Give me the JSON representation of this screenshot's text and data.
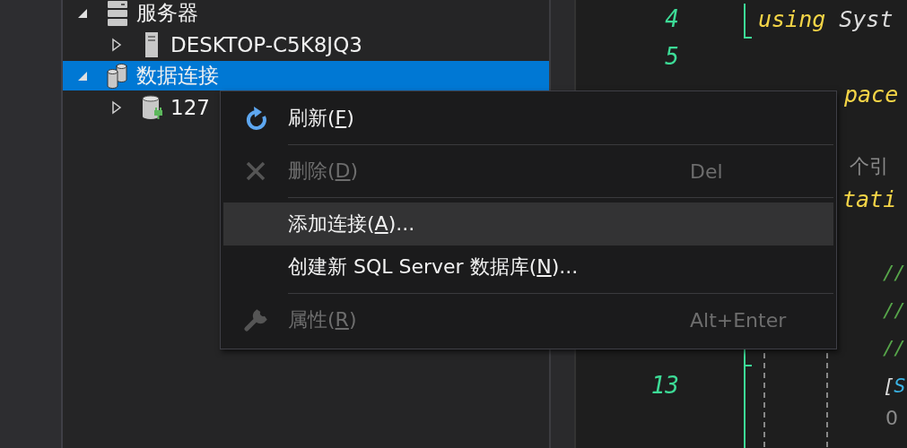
{
  "tree": {
    "items": [
      {
        "label": "服务器",
        "kind": "server",
        "expanded": true,
        "selected": false,
        "children": [
          {
            "label": "DESKTOP-C5K8JQ3",
            "kind": "computer",
            "expanded": false,
            "selected": false
          }
        ]
      },
      {
        "label": "数据连接",
        "kind": "databases",
        "expanded": true,
        "selected": true,
        "children": [
          {
            "label": "127",
            "kind": "database",
            "expanded": false,
            "selected": false
          }
        ]
      }
    ]
  },
  "editor": {
    "lines": [
      {
        "number": "4",
        "kind": "top",
        "tokens": [
          {
            "text": "using",
            "kind": "keyword"
          },
          {
            "text": "Syst",
            "kind": "plain"
          }
        ]
      },
      {
        "number": "5",
        "kind": "top"
      },
      {
        "kind": "behind",
        "tokens": [
          {
            "text": "pace",
            "kind": "keyword"
          }
        ]
      },
      {
        "kind": "hint",
        "tokens": [
          {
            "text": "个引",
            "kind": "hint"
          }
        ]
      },
      {
        "kind": "mid",
        "tokens": [
          {
            "text": "tati",
            "kind": "keyword"
          }
        ]
      },
      {
        "kind": "inner",
        "tokens": [
          {
            "text": "//",
            "kind": "comment"
          }
        ]
      },
      {
        "kind": "inner",
        "tokens": [
          {
            "text": "//",
            "kind": "comment"
          }
        ]
      },
      {
        "kind": "inner",
        "tokens": [
          {
            "text": "//",
            "kind": "comment"
          }
        ]
      },
      {
        "number": "13",
        "kind": "inner",
        "tokens": [
          {
            "text": "[",
            "kind": "plain"
          },
          {
            "text": "S",
            "kind": "type"
          }
        ]
      },
      {
        "kind": "hint-inner",
        "tokens": [
          {
            "text": "0",
            "kind": "hint"
          }
        ]
      }
    ]
  },
  "context_menu": {
    "items": [
      {
        "kind": "refresh",
        "before": "刷新(",
        "mnemonic": "F",
        "after": ")",
        "disabled": false,
        "highlighted": false
      },
      {
        "kind": "delete",
        "before": "删除(",
        "mnemonic": "D",
        "after": ")",
        "shortcut": "Del",
        "disabled": true,
        "highlighted": false,
        "separator_before": true
      },
      {
        "before": "添加连接(",
        "mnemonic": "A",
        "after": ")...",
        "disabled": false,
        "highlighted": true,
        "separator_before": true
      },
      {
        "before": "创建新 SQL Server 数据库(",
        "mnemonic": "N",
        "after": ")...",
        "disabled": false,
        "highlighted": false
      },
      {
        "kind": "properties",
        "before": "属性(",
        "mnemonic": "R",
        "after": ")",
        "shortcut": "Alt+Enter",
        "disabled": true,
        "highlighted": false,
        "separator_before": true
      }
    ]
  }
}
